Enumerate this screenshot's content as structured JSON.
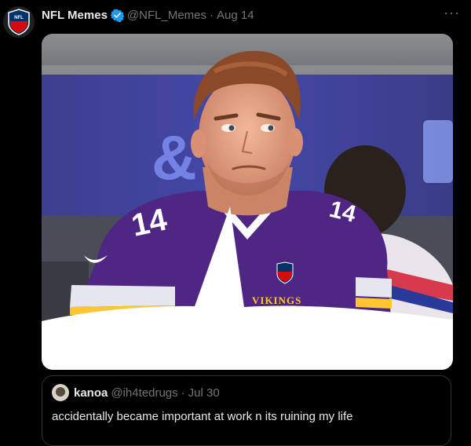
{
  "tweet": {
    "author_name": "NFL Memes",
    "author_handle": "@NFL_Memes",
    "separator": "·",
    "date": "Aug 14",
    "more_label": "···",
    "avatar_text": "NFL",
    "avatar_icon": "nfl-shield-icon"
  },
  "media": {
    "jersey_number": "14",
    "jersey_wordmark": "VIKINGS",
    "background_glyph": "&",
    "colors": {
      "jersey": "#4f2683",
      "accent_gold": "#ffc62f",
      "bubble": "#ffffff"
    }
  },
  "quote": {
    "author_name": "kanoa",
    "author_handle": "@ih4tedrugs",
    "separator": "·",
    "date": "Jul 30",
    "text": "accidentally became important at work n its ruining my life"
  }
}
